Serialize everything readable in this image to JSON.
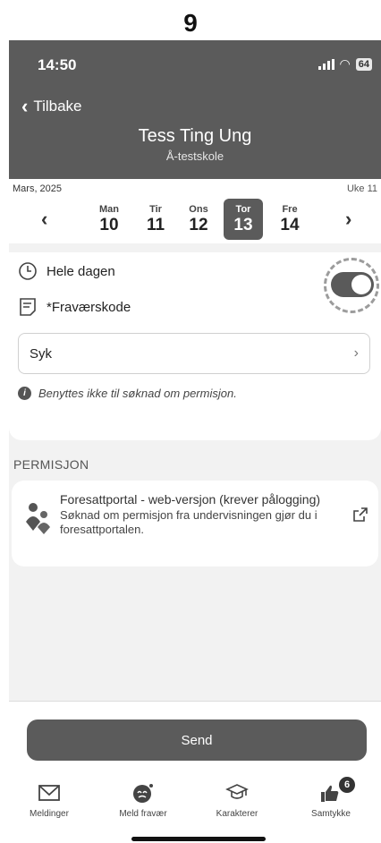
{
  "step_number": "9",
  "status_bar": {
    "time": "14:50",
    "battery": "64"
  },
  "header": {
    "back_label": "Tilbake",
    "student_name": "Tess Ting Ung",
    "school": "Å-testskole"
  },
  "week": {
    "month_label": "Mars, 2025",
    "week_label": "Uke 11",
    "days": [
      {
        "name": "Man",
        "number": "10"
      },
      {
        "name": "Tir",
        "number": "11"
      },
      {
        "name": "Ons",
        "number": "12"
      },
      {
        "name": "Tor",
        "number": "13"
      },
      {
        "name": "Fre",
        "number": "14"
      }
    ],
    "selected_day": "13"
  },
  "absence_form": {
    "all_day_label": "Hele dagen",
    "all_day_on": true,
    "absence_code_label": "*Fraværskode",
    "absence_code_value": "Syk",
    "info_text": "Benyttes ikke til søknad om permisjon."
  },
  "permission": {
    "section_title": "PERMISJON",
    "card_title": "Foresattportal - web-versjon (krever pålogging)",
    "card_description": "Søknad om permisjon fra undervisningen gjør du i foresattportalen."
  },
  "send_button_label": "Send",
  "tab_bar": {
    "items": [
      {
        "label": "Meldinger",
        "icon": "envelope-icon"
      },
      {
        "label": "Meld fravær",
        "icon": "report-absence-icon"
      },
      {
        "label": "Karakterer",
        "icon": "graduation-cap-icon"
      },
      {
        "label": "Samtykke",
        "icon": "thumbs-up-icon",
        "badge": "6"
      }
    ]
  },
  "colors": {
    "header_bg": "#5b5b5b",
    "selected_day_bg": "#5b5b5b",
    "button_bg": "#5b5b5b"
  }
}
